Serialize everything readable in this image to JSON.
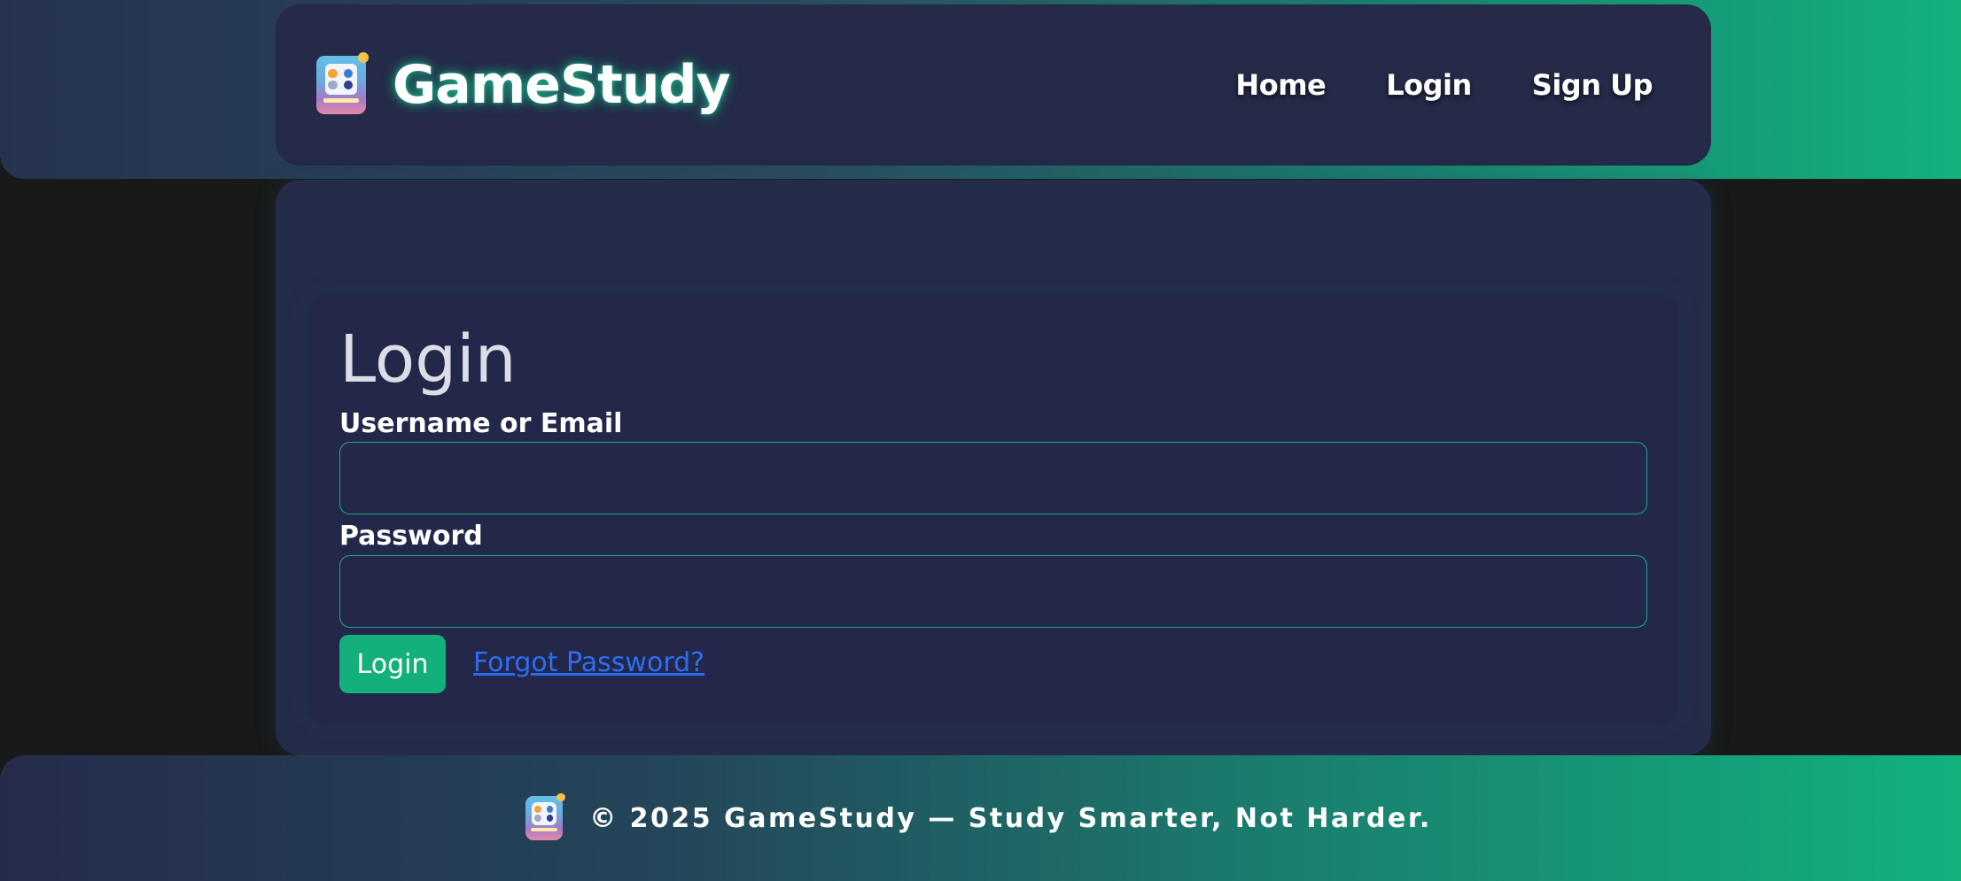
{
  "header": {
    "brand": "GameStudy",
    "logo_icon": "gamestudy-controller-icon",
    "nav": [
      {
        "label": "Home"
      },
      {
        "label": "Login"
      },
      {
        "label": "Sign Up"
      }
    ]
  },
  "login_form": {
    "title": "Login",
    "username_label": "Username or Email",
    "username_value": "",
    "password_label": "Password",
    "password_value": "",
    "submit_label": "Login",
    "forgot_label": "Forgot Password?"
  },
  "footer": {
    "logo_icon": "gamestudy-controller-icon",
    "text": "© 2025 GameStudy — Study Smarter, Not Harder."
  },
  "colors": {
    "accent": "#13b07c",
    "card": "#23284a",
    "link": "#2c6df2",
    "page_bg": "#181a19"
  }
}
